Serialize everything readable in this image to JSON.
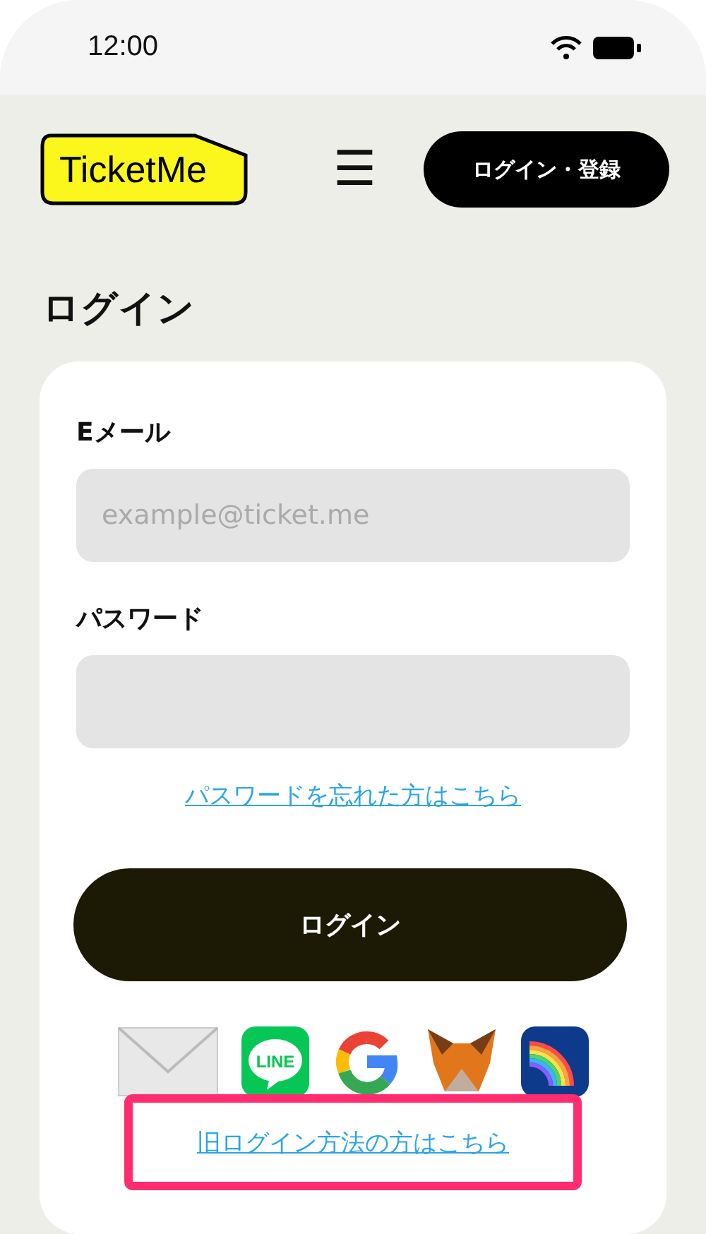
{
  "status_bar": {
    "time": "12:00"
  },
  "header": {
    "logo": "TicketMe",
    "menu_icon": "☰",
    "login_button": "ログイン・登録"
  },
  "page_title": "ログイン",
  "form": {
    "fields": [
      {
        "label": "Eメール",
        "placeholder": "example@ticket.me"
      },
      {
        "label": "パスワード"
      }
    ],
    "forgot_link": "パスワードを忘れた方はこちら",
    "submit": "ログイン"
  },
  "login_methods": [
    {
      "kind": "mail"
    },
    {
      "kind": "line",
      "label": "LINE"
    },
    {
      "kind": "google"
    },
    {
      "kind": "fox"
    },
    {
      "kind": "rainbow"
    }
  ],
  "legacy_link": {
    "text": "旧ログイン方法の方はこちら",
    "highlighted": true
  }
}
